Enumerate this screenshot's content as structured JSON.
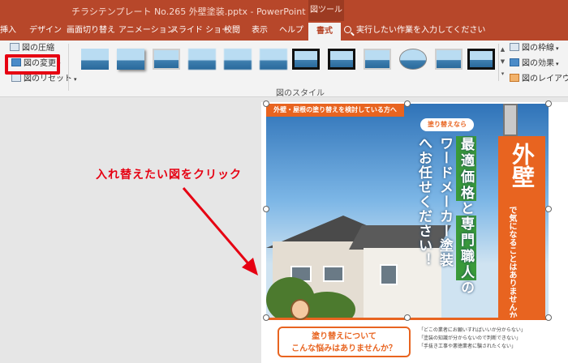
{
  "titlebar": {
    "document": "チラシテンプレート No.265 外壁塗装.pptx  -  PowerPoint",
    "context_tab": "図ツール"
  },
  "tabs": [
    {
      "label": "挿入"
    },
    {
      "label": "デザイン"
    },
    {
      "label": "画面切り替え"
    },
    {
      "label": "アニメーション"
    },
    {
      "label": "スライド ショー"
    },
    {
      "label": "校閲"
    },
    {
      "label": "表示"
    },
    {
      "label": "ヘルプ"
    },
    {
      "label": "書式",
      "active": true
    }
  ],
  "tellme": "実行したい作業を入力してください",
  "ribbon": {
    "compress": "図の圧縮",
    "change": "図の変更",
    "reset": "図のリセット",
    "group_label": "図のスタイル",
    "border": "図の枠線",
    "effects": "図の効果",
    "layout": "図のレイアウト"
  },
  "callout": "入れ替えたい図をクリック",
  "flyer": {
    "banner": "外壁・屋根の塗り替えを検討している方へ",
    "lead": "塗り替えなら",
    "line1_boxes": [
      "最",
      "適",
      "価",
      "格"
    ],
    "line1_mid": "と",
    "line1_boxes2": [
      "専",
      "門",
      "職",
      "人"
    ],
    "line1_tail": "の",
    "line2": "ワードメーカー塗装",
    "line3": "へお任せください！",
    "big": "外壁",
    "small": "で気になることはありませんか？"
  },
  "bottom": {
    "question_line1": "塗り替えについて",
    "question_line2": "こんな悩みはありませんか？",
    "worries": [
      "「どこの業者にお願いすればいいか分からない」",
      "「塗装の知識が分からないので判断できない」",
      "「手抜き工事や悪徳業者に騙されたくない」"
    ]
  },
  "colors": {
    "accent": "#b7472a",
    "callout": "#e60012",
    "flyer_orange": "#e86420"
  }
}
